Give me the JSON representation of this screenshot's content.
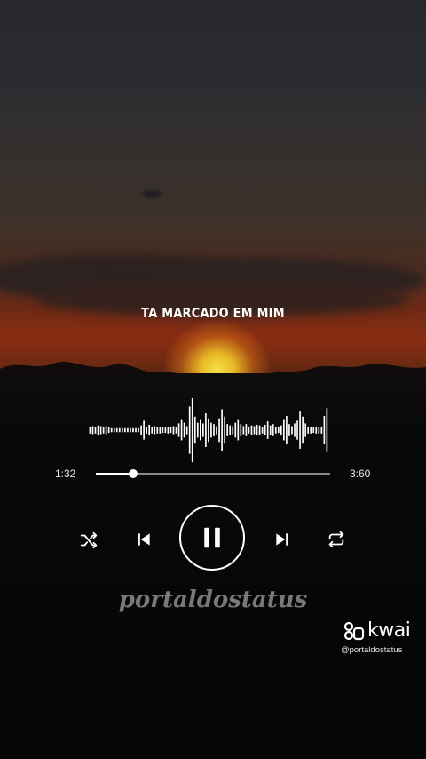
{
  "player": {
    "song_title": "TA MARCADO EM MIM",
    "current_time": "1:32",
    "total_time": "3:60",
    "progress": 0.16,
    "waveform": [
      0.1,
      0.12,
      0.1,
      0.14,
      0.12,
      0.1,
      0.12,
      0.08,
      0.06,
      0.06,
      0.06,
      0.06,
      0.06,
      0.06,
      0.06,
      0.06,
      0.06,
      0.06,
      0.06,
      0.14,
      0.28,
      0.1,
      0.16,
      0.1,
      0.12,
      0.1,
      0.1,
      0.08,
      0.08,
      0.1,
      0.08,
      0.12,
      0.1,
      0.2,
      0.3,
      0.22,
      0.12,
      0.7,
      0.95,
      0.4,
      0.22,
      0.3,
      0.2,
      0.5,
      0.35,
      0.22,
      0.18,
      0.12,
      0.35,
      0.62,
      0.4,
      0.18,
      0.14,
      0.12,
      0.22,
      0.3,
      0.18,
      0.12,
      0.18,
      0.1,
      0.14,
      0.12,
      0.16,
      0.14,
      0.1,
      0.16,
      0.26,
      0.14,
      0.18,
      0.1,
      0.08,
      0.14,
      0.3,
      0.42,
      0.18,
      0.12,
      0.2,
      0.28,
      0.55,
      0.4,
      0.2,
      0.1,
      0.1,
      0.08,
      0.1,
      0.1,
      0.1,
      0.42,
      0.65
    ]
  },
  "controls": {
    "shuffle": "shuffle-icon",
    "previous": "skip-previous-icon",
    "pause": "pause-icon",
    "next": "skip-next-icon",
    "repeat": "repeat-icon"
  },
  "overlay": {
    "watermark": "portaldostatus",
    "kwai_brand": "kwai",
    "kwai_handle": "@portaldostatus"
  },
  "colors": {
    "icon": "#ffffff",
    "track": "#8a8a8a",
    "watermark": "#8d8d8d"
  }
}
